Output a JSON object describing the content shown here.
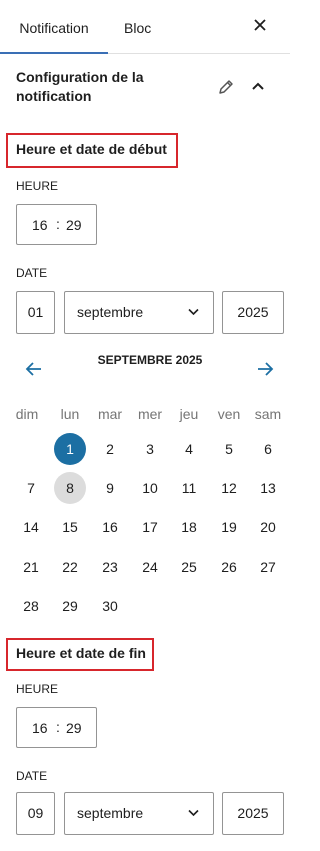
{
  "tabs": [
    {
      "label": "Notification",
      "active": true
    },
    {
      "label": "Bloc",
      "active": false
    }
  ],
  "panel": {
    "title": "Configuration de la notification"
  },
  "start": {
    "section_title": "Heure et date de début",
    "time_label": "HEURE",
    "hour": "16",
    "separator": ":",
    "minute": "29",
    "date_label": "DATE",
    "day": "01",
    "month": "septembre",
    "year": "2025"
  },
  "calendar": {
    "month_title": "SEPTEMBRE 2025",
    "weekdays": [
      "dim",
      "lun",
      "mar",
      "mer",
      "jeu",
      "ven",
      "sam"
    ],
    "weeks": [
      [
        "",
        "1",
        "2",
        "3",
        "4",
        "5",
        "6"
      ],
      [
        "7",
        "8",
        "9",
        "10",
        "11",
        "12",
        "13"
      ],
      [
        "14",
        "15",
        "16",
        "17",
        "18",
        "19",
        "20"
      ],
      [
        "21",
        "22",
        "23",
        "24",
        "25",
        "26",
        "27"
      ],
      [
        "28",
        "29",
        "30",
        "",
        "",
        "",
        ""
      ]
    ],
    "selected_day": "1",
    "today_day": "8",
    "accent_color": "#1c6fa3",
    "arrow_color": "#1c6fa3"
  },
  "end": {
    "section_title": "Heure et date de fin",
    "time_label": "HEURE",
    "hour": "16",
    "separator": ":",
    "minute": "29",
    "date_label": "DATE",
    "day": "09",
    "month": "septembre",
    "year": "2025"
  },
  "icons": {
    "close": "close-icon",
    "edit": "pencil-icon",
    "collapse": "chevron-up-icon",
    "prev": "arrow-left-icon",
    "next": "arrow-right-icon",
    "dropdown": "chevron-down-icon"
  },
  "colors": {
    "highlight_border": "#d7262c",
    "tab_indicator": "#3a6fb5"
  }
}
